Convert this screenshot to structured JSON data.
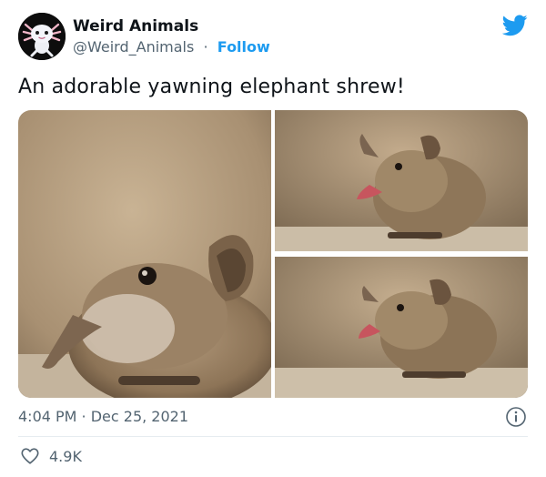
{
  "account": {
    "display_name": "Weird Animals",
    "handle": "@Weird_Animals",
    "separator": "·",
    "follow_label": "Follow"
  },
  "tweet": {
    "text": "An adorable yawning elephant shrew!",
    "timestamp": "4:04 PM · Dec 25, 2021",
    "like_count": "4.9K"
  },
  "media": [
    {
      "name": "elephant-shrew-closeup-photo"
    },
    {
      "name": "elephant-shrew-yawning-photo"
    },
    {
      "name": "elephant-shrew-yawning-photo-2"
    }
  ],
  "icons": {
    "avatar": "axolotl-avatar",
    "brand": "twitter-bird-icon",
    "info": "info-icon",
    "like": "heart-icon"
  },
  "colors": {
    "accent": "#1d9bf0",
    "text_primary": "#0f1419",
    "text_secondary": "#536471",
    "divider": "#e6ecf0"
  }
}
